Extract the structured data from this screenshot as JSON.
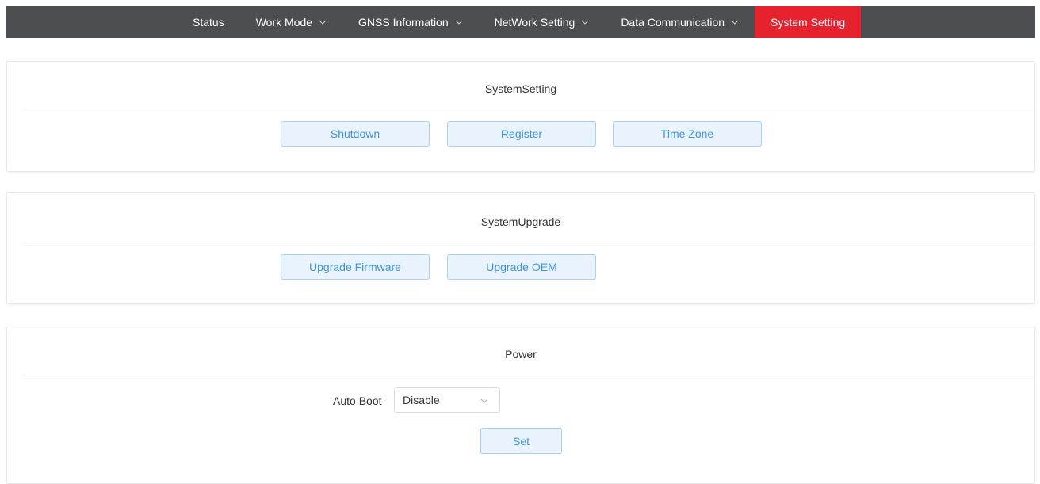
{
  "nav": {
    "items": [
      {
        "label": "Status",
        "dropdown": false,
        "active": false
      },
      {
        "label": "Work Mode",
        "dropdown": true,
        "active": false
      },
      {
        "label": "GNSS Information",
        "dropdown": true,
        "active": false
      },
      {
        "label": "NetWork Setting",
        "dropdown": true,
        "active": false
      },
      {
        "label": "Data Communication",
        "dropdown": true,
        "active": false
      },
      {
        "label": "System Setting",
        "dropdown": false,
        "active": true
      }
    ],
    "bar_color": "#4d4e51",
    "active_color": "#e6222f"
  },
  "system_setting": {
    "title": "SystemSetting",
    "buttons": [
      "Shutdown",
      "Register",
      "Time Zone"
    ]
  },
  "system_upgrade": {
    "title": "SystemUpgrade",
    "buttons": [
      "Upgrade Firmware",
      "Upgrade OEM"
    ]
  },
  "power": {
    "title": "Power",
    "auto_boot_label": "Auto Boot",
    "auto_boot_value": "Disable",
    "set_label": "Set"
  },
  "icons": {
    "dropdown": "chevron-down-icon"
  },
  "colors": {
    "button_text": "#3e93e0",
    "button_bg": "#e8f3fd",
    "button_border": "#a8d0f3"
  }
}
